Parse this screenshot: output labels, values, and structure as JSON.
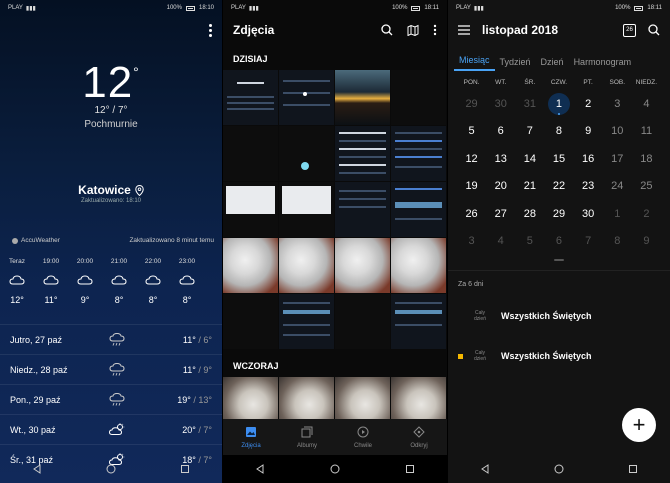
{
  "weather": {
    "status": {
      "carrier": "PLAY",
      "battery": "100%",
      "time": "18:10"
    },
    "temperature": "12",
    "degree": "°",
    "hilo": "12° / 7°",
    "condition": "Pochmurnie",
    "city": "Katowice",
    "updated": "Zaktualizowano: 18:10",
    "source": "AccuWeather",
    "source_updated": "Zaktualizowano 8 minut temu",
    "hourly": [
      {
        "time": "Teraz",
        "temp": "12°",
        "icon": "cloudy-icon"
      },
      {
        "time": "19:00",
        "temp": "11°",
        "icon": "cloudy-icon"
      },
      {
        "time": "20:00",
        "temp": "9°",
        "icon": "cloudy-icon"
      },
      {
        "time": "21:00",
        "temp": "8°",
        "icon": "cloudy-icon"
      },
      {
        "time": "22:00",
        "temp": "8°",
        "icon": "cloudy-icon"
      },
      {
        "time": "23:00",
        "temp": "8°",
        "icon": "cloudy-icon"
      }
    ],
    "daily": [
      {
        "day": "Jutro, 27 paź",
        "hi": "11°",
        "lo": "/ 6°",
        "icon": "rain-icon"
      },
      {
        "day": "Niedz., 28 paź",
        "hi": "11°",
        "lo": "/ 9°",
        "icon": "rain-icon"
      },
      {
        "day": "Pon., 29 paź",
        "hi": "19°",
        "lo": "/ 13°",
        "icon": "rain-icon"
      },
      {
        "day": "Wt., 30 paź",
        "hi": "20°",
        "lo": "/ 7°",
        "icon": "partly-sunny-icon"
      },
      {
        "day": "Śr., 31 paź",
        "hi": "18°",
        "lo": "/ 7°",
        "icon": "partly-sunny-icon"
      }
    ]
  },
  "photos": {
    "status": {
      "carrier": "PLAY",
      "battery": "100%",
      "time": "18:11"
    },
    "title": "Zdjęcia",
    "today": "DZISIAJ",
    "yesterday": "WCZORAJ",
    "tabs": [
      {
        "label": "Zdjęcia",
        "icon": "photo-icon"
      },
      {
        "label": "Albumy",
        "icon": "album-icon"
      },
      {
        "label": "Chwile",
        "icon": "moments-icon"
      },
      {
        "label": "Odkryj",
        "icon": "discover-icon"
      }
    ]
  },
  "calendar": {
    "status": {
      "carrier": "PLAY",
      "battery": "100%",
      "time": "18:11"
    },
    "title": "listopad 2018",
    "tabs": [
      "Miesiąc",
      "Tydzień",
      "Dzień",
      "Harmonogram"
    ],
    "today_badge": "26",
    "weekdays": [
      "PON.",
      "WT.",
      "ŚR.",
      "CZW.",
      "PT.",
      "SOB.",
      "NIEDZ."
    ],
    "weeks": [
      [
        "29",
        "30",
        "31",
        "1",
        "2",
        "3",
        "4"
      ],
      [
        "5",
        "6",
        "7",
        "8",
        "9",
        "10",
        "11"
      ],
      [
        "12",
        "13",
        "14",
        "15",
        "16",
        "17",
        "18"
      ],
      [
        "19",
        "20",
        "21",
        "22",
        "23",
        "24",
        "25"
      ],
      [
        "26",
        "27",
        "28",
        "29",
        "30",
        "1",
        "2"
      ],
      [
        "3",
        "4",
        "5",
        "6",
        "7",
        "8",
        "9"
      ]
    ],
    "ago": "Za 6 dni",
    "events": [
      {
        "allday": "Cały dzień",
        "name": "Wszystkich Świętych",
        "color": ""
      },
      {
        "allday": "Cały dzień",
        "name": "Wszystkich Świętych",
        "color": "#f5b800"
      }
    ]
  }
}
